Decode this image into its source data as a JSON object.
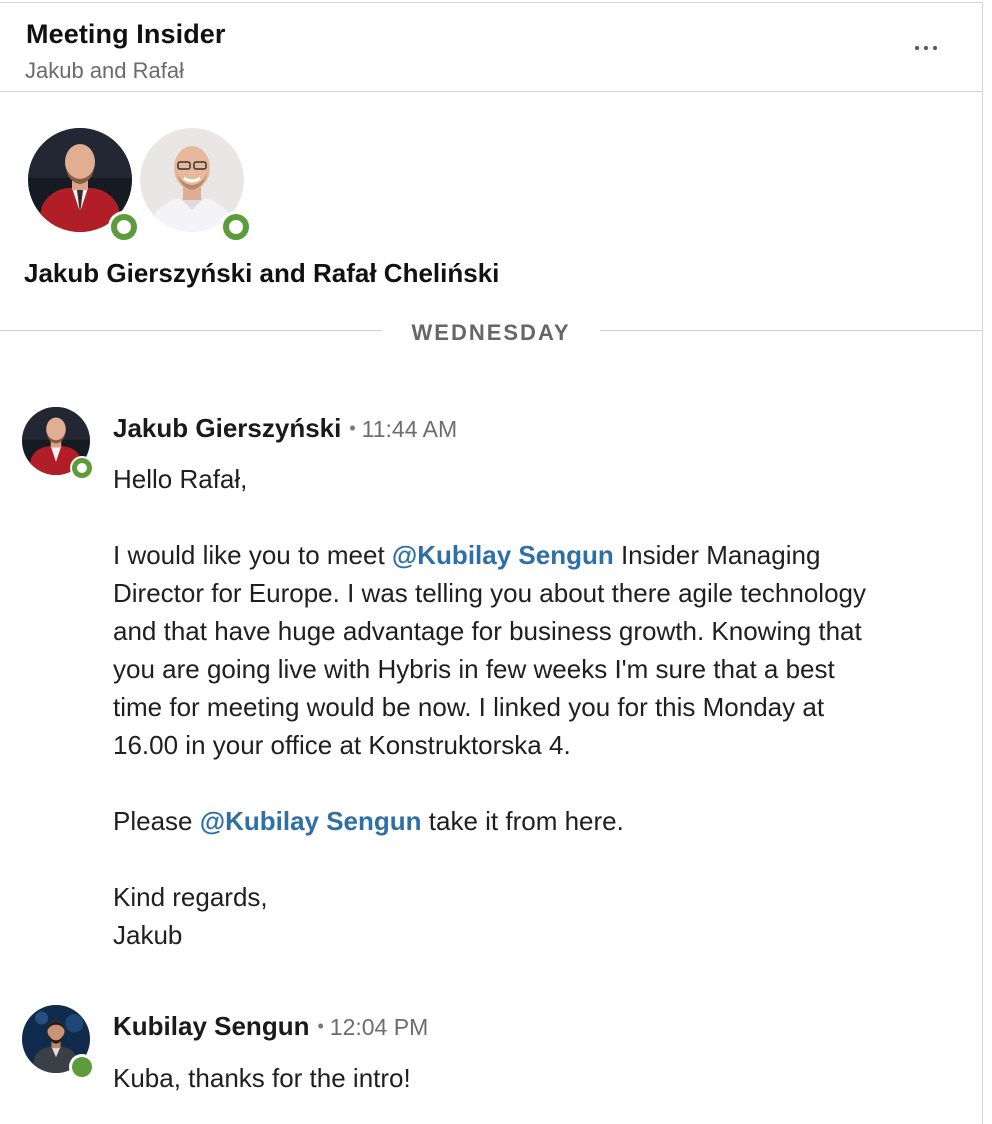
{
  "header": {
    "title": "Meeting Insider",
    "subtitle": "Jakub and Rafał",
    "more_icon": "more-horizontal-icon"
  },
  "participants": {
    "names": "Jakub Gierszyński and Rafał Cheliński",
    "avatars": [
      {
        "person": "Jakub Gierszyński",
        "online": true
      },
      {
        "person": "Rafał Cheliński",
        "online": true
      }
    ]
  },
  "divider": {
    "day": "WEDNESDAY"
  },
  "messages": [
    {
      "sender": "Jakub Gierszyński",
      "time": "11:44 AM",
      "bullet": "•",
      "greeting": "Hello Rafał,",
      "p1": {
        "l1_pre": "I would like you to meet ",
        "mention": "@Kubilay Sengun",
        "l1_post": " Insider Managing",
        "l2": "Director for Europe. I was telling you about there agile technology",
        "l3": "and that have huge advantage for business growth. Knowing that",
        "l4": "you are going live with Hybris in few weeks I'm sure that a best",
        "l5": "time for meeting would be now. I linked you for this Monday at",
        "l6": "16.00 in your office at Konstruktorska 4."
      },
      "p2": {
        "pre": "Please ",
        "mention": "@Kubilay Sengun",
        "post": " take it from here."
      },
      "signoff1": "Kind regards,",
      "signoff2": "Jakub"
    },
    {
      "sender": "Kubilay Sengun",
      "time": "12:04 PM",
      "bullet": "•",
      "text": "Kuba, thanks for the intro!"
    }
  ],
  "colors": {
    "presence": "#5c9c3b",
    "mention": "#2e6fa7"
  }
}
